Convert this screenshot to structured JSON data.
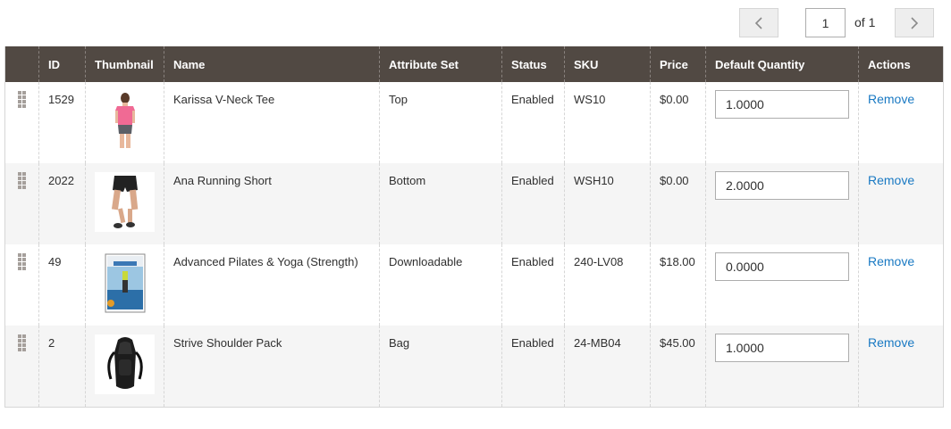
{
  "pager": {
    "current_page": "1",
    "of_label": "of 1"
  },
  "columns": [
    "",
    "ID",
    "Thumbnail",
    "Name",
    "Attribute Set",
    "Status",
    "SKU",
    "Price",
    "Default Quantity",
    "Actions"
  ],
  "rows": [
    {
      "id": "1529",
      "thumbnail": "pink-tee-image",
      "name": "Karissa V-Neck Tee",
      "attribute_set": "Top",
      "status": "Enabled",
      "sku": "WS10",
      "price": "$0.00",
      "default_quantity": "1.0000",
      "action": "Remove"
    },
    {
      "id": "2022",
      "thumbnail": "running-short-image",
      "name": "Ana Running Short",
      "attribute_set": "Bottom",
      "status": "Enabled",
      "sku": "WSH10",
      "price": "$0.00",
      "default_quantity": "2.0000",
      "action": "Remove"
    },
    {
      "id": "49",
      "thumbnail": "yoga-dvd-image",
      "name": "Advanced Pilates & Yoga (Strength)",
      "attribute_set": "Downloadable",
      "status": "Enabled",
      "sku": "240-LV08",
      "price": "$18.00",
      "default_quantity": "0.0000",
      "action": "Remove"
    },
    {
      "id": "2",
      "thumbnail": "black-backpack-image",
      "name": "Strive Shoulder Pack",
      "attribute_set": "Bag",
      "status": "Enabled",
      "sku": "24-MB04",
      "price": "$45.00",
      "default_quantity": "1.0000",
      "action": "Remove"
    }
  ],
  "colors": {
    "header_bg": "#514943",
    "link": "#1979c3",
    "row_alt_bg": "#f5f5f5"
  },
  "icons": {
    "prev": "chevron-left-icon",
    "next": "chevron-right-icon",
    "drag": "drag-handle-icon"
  }
}
